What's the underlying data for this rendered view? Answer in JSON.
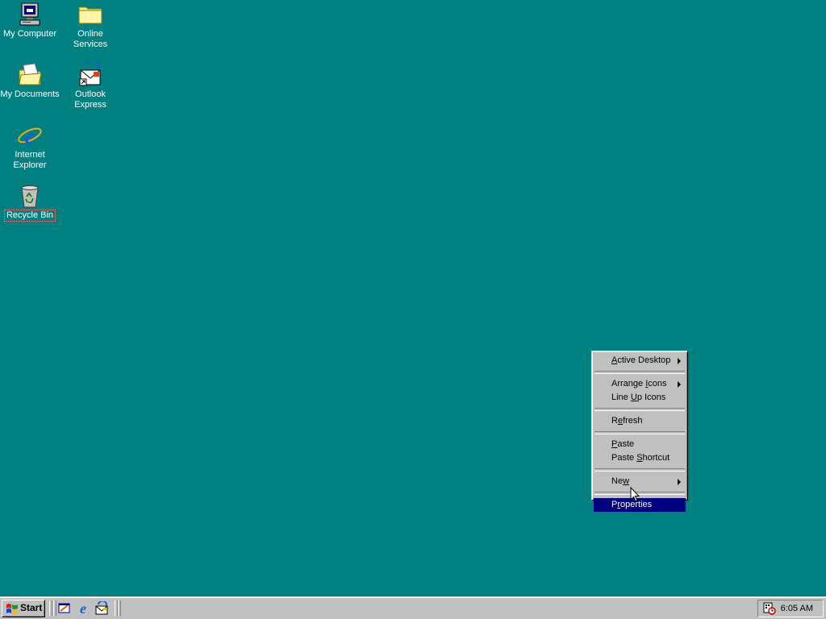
{
  "desktop": {
    "background": "#008080",
    "icons": [
      {
        "label": "My Computer"
      },
      {
        "label": "Online\nServices"
      },
      {
        "label": "My Documents"
      },
      {
        "label": "Outlook\nExpress"
      },
      {
        "label": "Internet\nExplorer"
      },
      {
        "label": "Recycle Bin"
      }
    ]
  },
  "context_menu": {
    "items": [
      {
        "pre": "",
        "mn": "A",
        "post": "ctive Desktop",
        "submenu": true
      },
      {
        "pre": "Arrange ",
        "mn": "I",
        "post": "cons",
        "submenu": true
      },
      {
        "pre": "Line ",
        "mn": "U",
        "post": "p Icons"
      },
      {
        "pre": "R",
        "mn": "e",
        "post": "fresh"
      },
      {
        "pre": "",
        "mn": "P",
        "post": "aste"
      },
      {
        "pre": "Paste ",
        "mn": "S",
        "post": "hortcut"
      },
      {
        "pre": "Ne",
        "mn": "w",
        "post": "",
        "submenu": true
      },
      {
        "pre": "P",
        "mn": "r",
        "post": "operties",
        "highlighted": true
      }
    ],
    "highlight_color": "#000080"
  },
  "taskbar": {
    "start_label": "Start",
    "quick_launch": [
      "show-desktop-icon",
      "internet-explorer-icon",
      "outlook-express-icon"
    ],
    "tray": {
      "clock": "6:05 AM",
      "icons": [
        "task-scheduler-icon"
      ]
    }
  }
}
